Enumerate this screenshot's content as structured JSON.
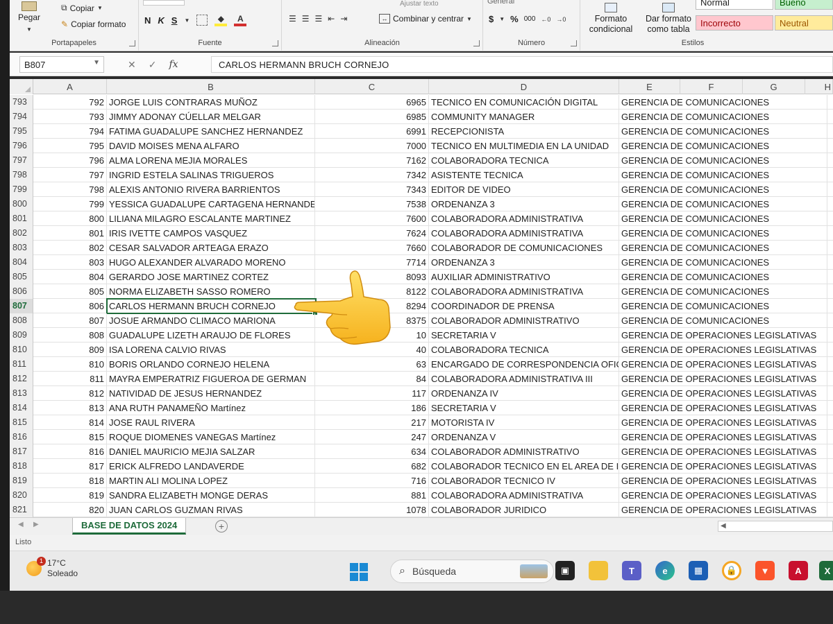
{
  "ribbon": {
    "clipboard": {
      "paste": "Pegar",
      "copy": "Copiar",
      "format_painter": "Copiar formato",
      "label": "Portapapeles"
    },
    "font": {
      "bold": "N",
      "italic": "K",
      "underline": "S",
      "label": "Fuente"
    },
    "alignment": {
      "merge": "Combinar y centrar",
      "wrap": "Ajustar texto",
      "label": "Alineación"
    },
    "number": {
      "format": "General",
      "currency": "$",
      "percent": "%",
      "thousands": "000",
      "label": "Número"
    },
    "styles": {
      "conditional": "Formato condicional",
      "as_table": "Dar formato como tabla",
      "normal": "Normal",
      "good": "Bueno",
      "bad": "Incorrecto",
      "neutral": "Neutral",
      "label": "Estilos"
    }
  },
  "formula_bar": {
    "name_box": "B807",
    "fx": "fx",
    "content": "CARLOS HERMANN BRUCH CORNEJO"
  },
  "columns": [
    "A",
    "B",
    "C",
    "D",
    "E",
    "F",
    "G",
    "H"
  ],
  "rows": [
    {
      "rn": "793",
      "a": "792",
      "b": "JORGE LUIS CONTRARAS MUÑOZ",
      "c": "6965",
      "d": "TECNICO EN COMUNICACIÓN DIGITAL",
      "e": "GERENCIA DE COMUNICACIONES"
    },
    {
      "rn": "794",
      "a": "793",
      "b": "JIMMY ADONAY CÚELLAR MELGAR",
      "c": "6985",
      "d": "COMMUNITY MANAGER",
      "e": "GERENCIA DE COMUNICACIONES"
    },
    {
      "rn": "795",
      "a": "794",
      "b": "FATIMA GUADALUPE SANCHEZ HERNANDEZ",
      "c": "6991",
      "d": "RECEPCIONISTA",
      "e": "GERENCIA DE COMUNICACIONES"
    },
    {
      "rn": "796",
      "a": "795",
      "b": "DAVID MOISES MENA ALFARO",
      "c": "7000",
      "d": "TECNICO EN MULTIMEDIA EN LA UNIDAD",
      "e": "GERENCIA DE COMUNICACIONES"
    },
    {
      "rn": "797",
      "a": "796",
      "b": "ALMA LORENA MEJIA MORALES",
      "c": "7162",
      "d": "COLABORADORA TECNICA",
      "e": "GERENCIA DE COMUNICACIONES"
    },
    {
      "rn": "798",
      "a": "797",
      "b": "INGRID ESTELA SALINAS TRIGUEROS",
      "c": "7342",
      "d": "ASISTENTE TECNICA",
      "e": "GERENCIA DE COMUNICACIONES"
    },
    {
      "rn": "799",
      "a": "798",
      "b": "ALEXIS ANTONIO RIVERA BARRIENTOS",
      "c": "7343",
      "d": "EDITOR DE VIDEO",
      "e": "GERENCIA DE COMUNICACIONES"
    },
    {
      "rn": "800",
      "a": "799",
      "b": "YESSICA GUADALUPE CARTAGENA HERNANDEZ",
      "c": "7538",
      "d": "ORDENANZA 3",
      "e": "GERENCIA DE COMUNICACIONES"
    },
    {
      "rn": "801",
      "a": "800",
      "b": "LILIANA MILAGRO ESCALANTE MARTINEZ",
      "c": "7600",
      "d": "COLABORADORA ADMINISTRATIVA",
      "e": "GERENCIA DE COMUNICACIONES"
    },
    {
      "rn": "802",
      "a": "801",
      "b": "IRIS IVETTE CAMPOS VASQUEZ",
      "c": "7624",
      "d": "COLABORADORA ADMINISTRATIVA",
      "e": "GERENCIA DE COMUNICACIONES"
    },
    {
      "rn": "803",
      "a": "802",
      "b": "CESAR SALVADOR ARTEAGA ERAZO",
      "c": "7660",
      "d": "COLABORADOR DE COMUNICACIONES",
      "e": "GERENCIA DE COMUNICACIONES"
    },
    {
      "rn": "804",
      "a": "803",
      "b": "HUGO ALEXANDER ALVARADO MORENO",
      "c": "7714",
      "d": "ORDENANZA 3",
      "e": "GERENCIA DE COMUNICACIONES"
    },
    {
      "rn": "805",
      "a": "804",
      "b": "GERARDO JOSE MARTINEZ CORTEZ",
      "c": "8093",
      "d": "AUXILIAR ADMINISTRATIVO",
      "e": "GERENCIA DE COMUNICACIONES"
    },
    {
      "rn": "806",
      "a": "805",
      "b": "NORMA ELIZABETH SASSO ROMERO",
      "c": "8122",
      "d": "COLABORADORA ADMINISTRATIVA",
      "e": "GERENCIA DE COMUNICACIONES"
    },
    {
      "rn": "807",
      "a": "806",
      "b": "CARLOS HERMANN BRUCH CORNEJO",
      "c": "8294",
      "d": "COORDINADOR DE PRENSA",
      "e": "GERENCIA DE COMUNICACIONES",
      "selected": true
    },
    {
      "rn": "808",
      "a": "807",
      "b": "JOSUE ARMANDO CLIMACO MARIONA",
      "c": "8375",
      "d": "COLABORADOR ADMINISTRATIVO",
      "e": "GERENCIA DE COMUNICACIONES"
    },
    {
      "rn": "809",
      "a": "808",
      "b": "GUADALUPE LIZETH ARAUJO DE FLORES",
      "c": "10",
      "d": "SECRETARIA V",
      "e": "GERENCIA DE OPERACIONES LEGISLATIVAS"
    },
    {
      "rn": "810",
      "a": "809",
      "b": "ISA LORENA CALVIO RIVAS",
      "c": "40",
      "d": "COLABORADORA TECNICA",
      "e": "GERENCIA DE OPERACIONES LEGISLATIVAS"
    },
    {
      "rn": "811",
      "a": "810",
      "b": "BORIS ORLANDO CORNEJO HELENA",
      "c": "63",
      "d": "ENCARGADO DE CORRESPONDENCIA OFIC",
      "e": "GERENCIA DE OPERACIONES LEGISLATIVAS"
    },
    {
      "rn": "812",
      "a": "811",
      "b": "MAYRA EMPERATRIZ FIGUEROA DE GERMAN",
      "c": "84",
      "d": "COLABORADORA ADMINISTRATIVA III",
      "e": "GERENCIA DE OPERACIONES LEGISLATIVAS"
    },
    {
      "rn": "813",
      "a": "812",
      "b": "NATIVIDAD DE JESUS HERNANDEZ",
      "c": "117",
      "d": "ORDENANZA IV",
      "e": "GERENCIA DE OPERACIONES LEGISLATIVAS"
    },
    {
      "rn": "814",
      "a": "813",
      "b": "ANA RUTH PANAMEÑO Martínez",
      "c": "186",
      "d": "SECRETARIA V",
      "e": "GERENCIA DE OPERACIONES LEGISLATIVAS"
    },
    {
      "rn": "815",
      "a": "814",
      "b": "JOSE RAUL RIVERA",
      "c": "217",
      "d": "MOTORISTA IV",
      "e": "GERENCIA DE OPERACIONES LEGISLATIVAS"
    },
    {
      "rn": "816",
      "a": "815",
      "b": "ROQUE DIOMENES VANEGAS Martínez",
      "c": "247",
      "d": "ORDENANZA V",
      "e": "GERENCIA DE OPERACIONES LEGISLATIVAS"
    },
    {
      "rn": "817",
      "a": "816",
      "b": "DANIEL MAURICIO MEJIA SALZAR",
      "c": "634",
      "d": "COLABORADOR ADMINISTRATIVO",
      "e": "GERENCIA DE OPERACIONES LEGISLATIVAS"
    },
    {
      "rn": "818",
      "a": "817",
      "b": "ERICK ALFREDO LANDAVERDE",
      "c": "682",
      "d": "COLABORADOR TECNICO EN EL AREA DE I",
      "e": "GERENCIA DE OPERACIONES LEGISLATIVAS"
    },
    {
      "rn": "819",
      "a": "818",
      "b": "MARTIN ALI MOLINA LOPEZ",
      "c": "716",
      "d": "COLABORADOR TECNICO IV",
      "e": "GERENCIA DE OPERACIONES LEGISLATIVAS"
    },
    {
      "rn": "820",
      "a": "819",
      "b": "SANDRA ELIZABETH MONGE DERAS",
      "c": "881",
      "d": "COLABORADORA ADMINISTRATIVA",
      "e": "GERENCIA DE OPERACIONES LEGISLATIVAS"
    },
    {
      "rn": "821",
      "a": "820",
      "b": "JUAN CARLOS GUZMAN RIVAS",
      "c": "1078",
      "d": "COLABORADOR JURIDICO",
      "e": "GERENCIA DE OPERACIONES LEGISLATIVAS"
    }
  ],
  "sheet_tabs": {
    "active": "BASE DE DATOS 2024",
    "add": "+"
  },
  "status_bar": {
    "text": "Listo"
  },
  "taskbar": {
    "weather_temp": "17°C",
    "weather_desc": "Soleado",
    "weather_badge": "1",
    "search_placeholder": "Búsqueda"
  },
  "colors": {
    "excel_green": "#1e6b3a",
    "bad_fill": "#ffc7ce",
    "neutral_fill": "#ffeb9c",
    "good_fill": "#c6efce"
  }
}
